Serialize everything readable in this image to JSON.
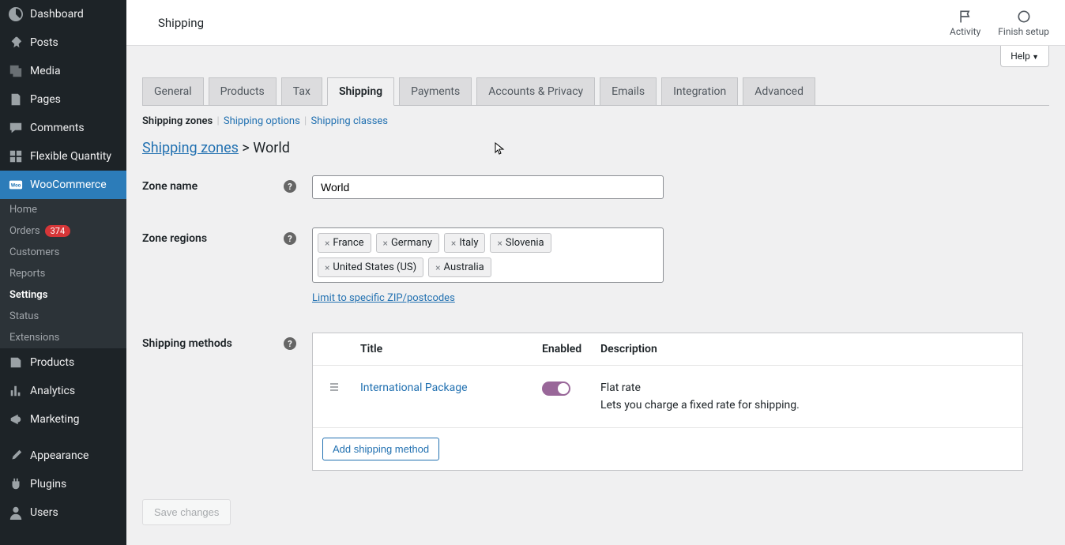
{
  "sidebar": {
    "items": [
      {
        "label": "Dashboard"
      },
      {
        "label": "Posts"
      },
      {
        "label": "Media"
      },
      {
        "label": "Pages"
      },
      {
        "label": "Comments"
      },
      {
        "label": "Flexible Quantity"
      },
      {
        "label": "WooCommerce"
      },
      {
        "label": "Products"
      },
      {
        "label": "Analytics"
      },
      {
        "label": "Marketing"
      },
      {
        "label": "Appearance"
      },
      {
        "label": "Plugins"
      },
      {
        "label": "Users"
      }
    ],
    "sub": {
      "items": [
        {
          "label": "Home"
        },
        {
          "label": "Orders",
          "badge": "374"
        },
        {
          "label": "Customers"
        },
        {
          "label": "Reports"
        },
        {
          "label": "Settings"
        },
        {
          "label": "Status"
        },
        {
          "label": "Extensions"
        }
      ]
    }
  },
  "header": {
    "title": "Shipping",
    "actions": {
      "activity": "Activity",
      "finish_setup": "Finish setup"
    },
    "help": "Help"
  },
  "tabs": [
    {
      "label": "General"
    },
    {
      "label": "Products"
    },
    {
      "label": "Tax"
    },
    {
      "label": "Shipping"
    },
    {
      "label": "Payments"
    },
    {
      "label": "Accounts & Privacy"
    },
    {
      "label": "Emails"
    },
    {
      "label": "Integration"
    },
    {
      "label": "Advanced"
    }
  ],
  "subtabs": {
    "zones": "Shipping zones",
    "options": "Shipping options",
    "classes": "Shipping classes"
  },
  "breadcrumb": {
    "root": "Shipping zones",
    "sep": " > ",
    "current": "World"
  },
  "form": {
    "zone_name_label": "Zone name",
    "zone_name_value": "World",
    "zone_regions_label": "Zone regions",
    "regions": [
      "France",
      "Germany",
      "Italy",
      "Slovenia",
      "United States (US)",
      "Australia"
    ],
    "limit_link": "Limit to specific ZIP/postcodes",
    "shipping_methods_label": "Shipping methods"
  },
  "methods": {
    "headers": {
      "title": "Title",
      "enabled": "Enabled",
      "description": "Description"
    },
    "rows": [
      {
        "title": "International Package",
        "desc_title": "Flat rate",
        "desc_text": "Lets you charge a fixed rate for shipping."
      }
    ],
    "add_button": "Add shipping method"
  },
  "save_button": "Save changes"
}
